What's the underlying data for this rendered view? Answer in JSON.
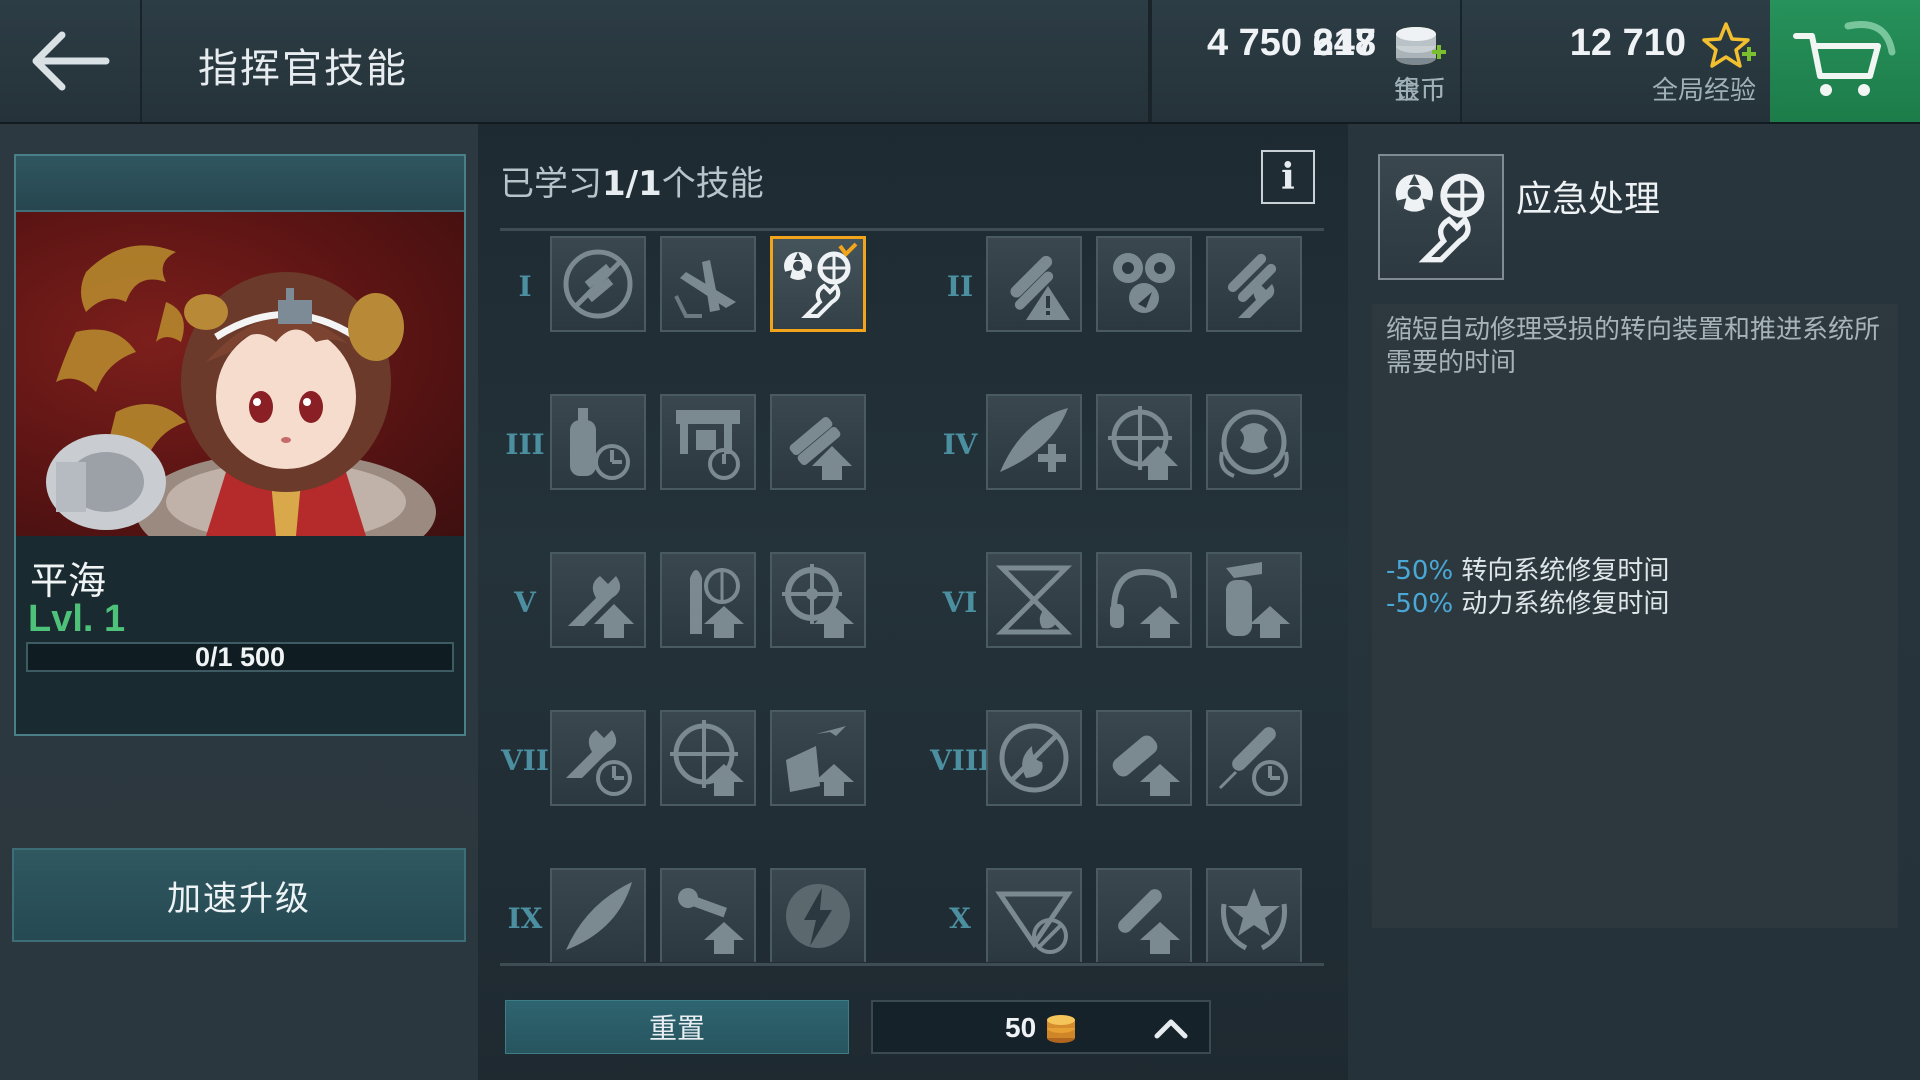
{
  "header": {
    "title": "指挥官技能",
    "gold": {
      "amount": "218",
      "label": "金币"
    },
    "silver": {
      "amount": "4 750 647",
      "label": "银币"
    },
    "xp": {
      "amount": "12 710",
      "label": "全局经验"
    }
  },
  "commander": {
    "name": "平海",
    "level": "Lvl. 1",
    "xp_text": "0/1 500",
    "xp_progress": 0.0,
    "speed_button": "加速升级"
  },
  "skills": {
    "learned_text_prefix": "已学习",
    "learned_count": "1/1",
    "learned_text_suffix": "个技能",
    "info_label": "i",
    "tiers": [
      "I",
      "II",
      "III",
      "IV",
      "V",
      "VI",
      "VII",
      "VIII",
      "IX",
      "X"
    ],
    "selected_skill": "emergency-repair",
    "reset_label": "重置",
    "reset_cost": "50"
  },
  "detail": {
    "title": "应急处理",
    "description": "缩短自动修理受损的转向装置和推进系统所需要的时间",
    "effects": [
      {
        "pct": "-50%",
        "text": " 转向系统修复时间"
      },
      {
        "pct": "-50%",
        "text": " 动力系统修复时间"
      }
    ]
  },
  "colors": {
    "accent": "#4b8fa0",
    "selected_border": "#f2a51a",
    "level_green": "#4fc27a",
    "cart_green": "#27925b",
    "effect_blue": "#4aa8d6"
  }
}
